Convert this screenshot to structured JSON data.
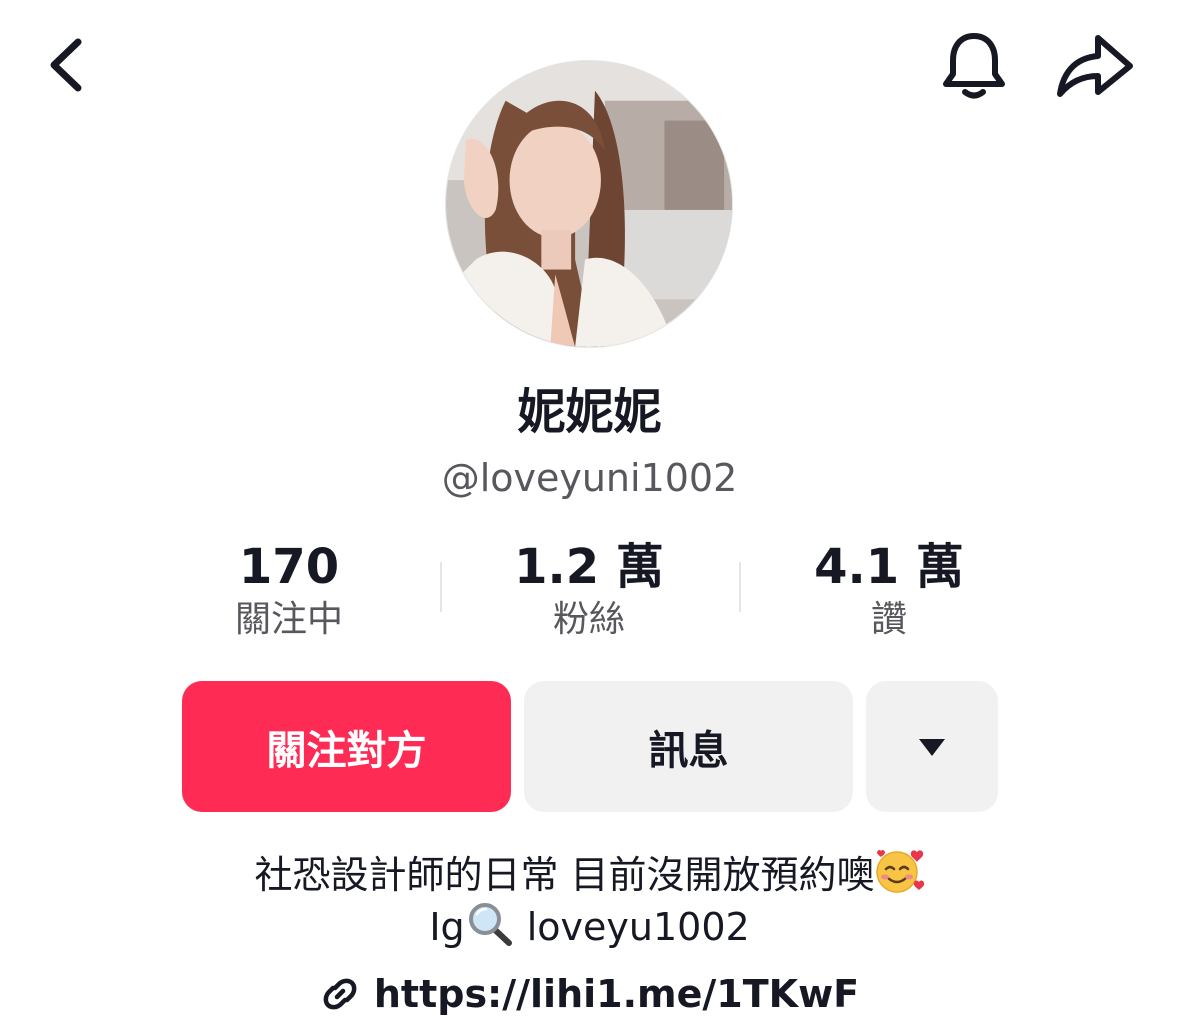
{
  "header": {
    "back_icon": "chevron-left-icon",
    "bell_icon": "bell-icon",
    "share_icon": "share-arrow-icon"
  },
  "profile": {
    "display_name": "妮妮妮",
    "username": "@loveyuni1002"
  },
  "stats": [
    {
      "value": "170",
      "label": "關注中"
    },
    {
      "value": "1.2 萬",
      "label": "粉絲"
    },
    {
      "value": "4.1 萬",
      "label": "讚"
    }
  ],
  "actions": {
    "follow_label": "關注對方",
    "message_label": "訊息",
    "more_icon": "caret-down-icon"
  },
  "bio": {
    "line1_text": "社恐設計師的日常 目前沒開放預約噢",
    "line1_emoji": "smiling-face-with-hearts-icon",
    "line2_prefix": "Ig",
    "line2_emoji": "magnifying-glass-icon",
    "line2_text": " loveyu1002"
  },
  "link": {
    "icon": "link-icon",
    "url": "https://lihi1.me/1TKwF"
  },
  "colors": {
    "accent": "#fe2c55",
    "secondary_button": "#f1f1f2",
    "text_primary": "#161823",
    "text_secondary": "#57575d"
  }
}
